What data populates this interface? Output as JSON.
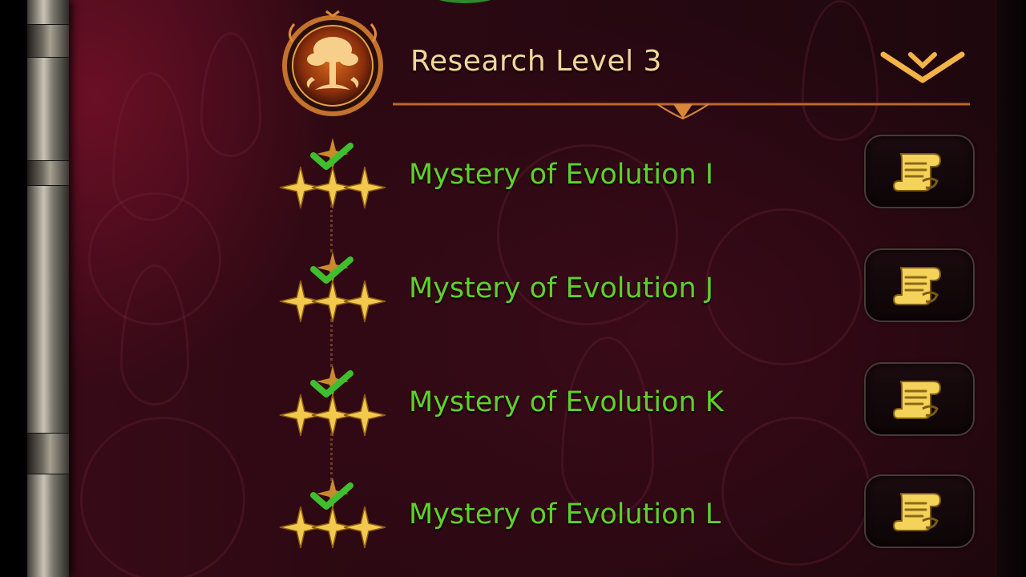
{
  "header": {
    "title": "Research Level 3",
    "emblem_icon": "tree-crest-icon",
    "toggle_icon": "chevron-down-icon"
  },
  "research_items": [
    {
      "name": "Mystery of Evolution I",
      "stars": 3,
      "completed": true,
      "action_icon": "scroll-icon"
    },
    {
      "name": "Mystery of Evolution J",
      "stars": 3,
      "completed": true,
      "action_icon": "scroll-icon"
    },
    {
      "name": "Mystery of Evolution K",
      "stars": 3,
      "completed": true,
      "action_icon": "scroll-icon"
    },
    {
      "name": "Mystery of Evolution L",
      "stars": 3,
      "completed": true,
      "action_icon": "scroll-icon"
    }
  ],
  "colors": {
    "title_gold": "#f3d79a",
    "item_green": "#5fd02c",
    "check_green": "#3fbf2e",
    "star_gold": "#f2c94c",
    "background": "#2c0912"
  }
}
